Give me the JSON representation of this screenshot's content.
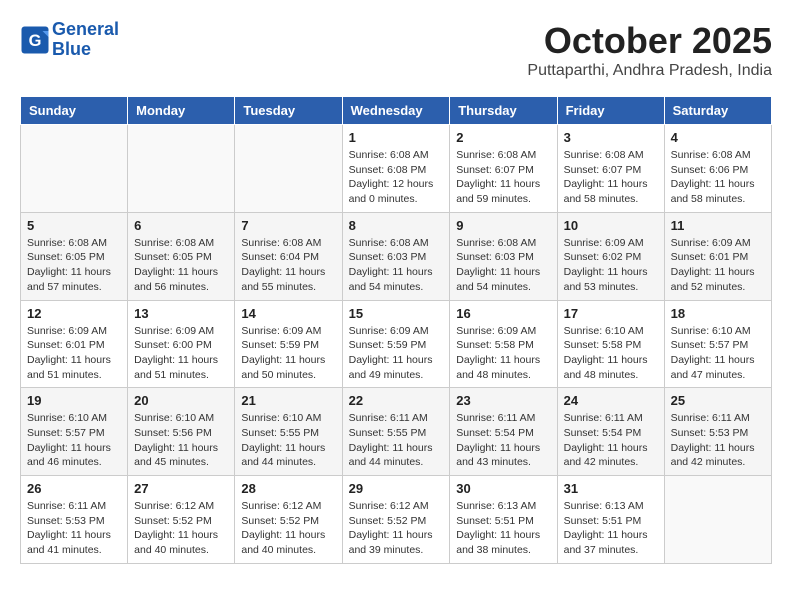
{
  "header": {
    "logo_line1": "General",
    "logo_line2": "Blue",
    "month": "October 2025",
    "location": "Puttaparthi, Andhra Pradesh, India"
  },
  "weekdays": [
    "Sunday",
    "Monday",
    "Tuesday",
    "Wednesday",
    "Thursday",
    "Friday",
    "Saturday"
  ],
  "weeks": [
    [
      {
        "day": "",
        "info": ""
      },
      {
        "day": "",
        "info": ""
      },
      {
        "day": "",
        "info": ""
      },
      {
        "day": "1",
        "info": "Sunrise: 6:08 AM\nSunset: 6:08 PM\nDaylight: 12 hours\nand 0 minutes."
      },
      {
        "day": "2",
        "info": "Sunrise: 6:08 AM\nSunset: 6:07 PM\nDaylight: 11 hours\nand 59 minutes."
      },
      {
        "day": "3",
        "info": "Sunrise: 6:08 AM\nSunset: 6:07 PM\nDaylight: 11 hours\nand 58 minutes."
      },
      {
        "day": "4",
        "info": "Sunrise: 6:08 AM\nSunset: 6:06 PM\nDaylight: 11 hours\nand 58 minutes."
      }
    ],
    [
      {
        "day": "5",
        "info": "Sunrise: 6:08 AM\nSunset: 6:05 PM\nDaylight: 11 hours\nand 57 minutes."
      },
      {
        "day": "6",
        "info": "Sunrise: 6:08 AM\nSunset: 6:05 PM\nDaylight: 11 hours\nand 56 minutes."
      },
      {
        "day": "7",
        "info": "Sunrise: 6:08 AM\nSunset: 6:04 PM\nDaylight: 11 hours\nand 55 minutes."
      },
      {
        "day": "8",
        "info": "Sunrise: 6:08 AM\nSunset: 6:03 PM\nDaylight: 11 hours\nand 54 minutes."
      },
      {
        "day": "9",
        "info": "Sunrise: 6:08 AM\nSunset: 6:03 PM\nDaylight: 11 hours\nand 54 minutes."
      },
      {
        "day": "10",
        "info": "Sunrise: 6:09 AM\nSunset: 6:02 PM\nDaylight: 11 hours\nand 53 minutes."
      },
      {
        "day": "11",
        "info": "Sunrise: 6:09 AM\nSunset: 6:01 PM\nDaylight: 11 hours\nand 52 minutes."
      }
    ],
    [
      {
        "day": "12",
        "info": "Sunrise: 6:09 AM\nSunset: 6:01 PM\nDaylight: 11 hours\nand 51 minutes."
      },
      {
        "day": "13",
        "info": "Sunrise: 6:09 AM\nSunset: 6:00 PM\nDaylight: 11 hours\nand 51 minutes."
      },
      {
        "day": "14",
        "info": "Sunrise: 6:09 AM\nSunset: 5:59 PM\nDaylight: 11 hours\nand 50 minutes."
      },
      {
        "day": "15",
        "info": "Sunrise: 6:09 AM\nSunset: 5:59 PM\nDaylight: 11 hours\nand 49 minutes."
      },
      {
        "day": "16",
        "info": "Sunrise: 6:09 AM\nSunset: 5:58 PM\nDaylight: 11 hours\nand 48 minutes."
      },
      {
        "day": "17",
        "info": "Sunrise: 6:10 AM\nSunset: 5:58 PM\nDaylight: 11 hours\nand 48 minutes."
      },
      {
        "day": "18",
        "info": "Sunrise: 6:10 AM\nSunset: 5:57 PM\nDaylight: 11 hours\nand 47 minutes."
      }
    ],
    [
      {
        "day": "19",
        "info": "Sunrise: 6:10 AM\nSunset: 5:57 PM\nDaylight: 11 hours\nand 46 minutes."
      },
      {
        "day": "20",
        "info": "Sunrise: 6:10 AM\nSunset: 5:56 PM\nDaylight: 11 hours\nand 45 minutes."
      },
      {
        "day": "21",
        "info": "Sunrise: 6:10 AM\nSunset: 5:55 PM\nDaylight: 11 hours\nand 44 minutes."
      },
      {
        "day": "22",
        "info": "Sunrise: 6:11 AM\nSunset: 5:55 PM\nDaylight: 11 hours\nand 44 minutes."
      },
      {
        "day": "23",
        "info": "Sunrise: 6:11 AM\nSunset: 5:54 PM\nDaylight: 11 hours\nand 43 minutes."
      },
      {
        "day": "24",
        "info": "Sunrise: 6:11 AM\nSunset: 5:54 PM\nDaylight: 11 hours\nand 42 minutes."
      },
      {
        "day": "25",
        "info": "Sunrise: 6:11 AM\nSunset: 5:53 PM\nDaylight: 11 hours\nand 42 minutes."
      }
    ],
    [
      {
        "day": "26",
        "info": "Sunrise: 6:11 AM\nSunset: 5:53 PM\nDaylight: 11 hours\nand 41 minutes."
      },
      {
        "day": "27",
        "info": "Sunrise: 6:12 AM\nSunset: 5:52 PM\nDaylight: 11 hours\nand 40 minutes."
      },
      {
        "day": "28",
        "info": "Sunrise: 6:12 AM\nSunset: 5:52 PM\nDaylight: 11 hours\nand 40 minutes."
      },
      {
        "day": "29",
        "info": "Sunrise: 6:12 AM\nSunset: 5:52 PM\nDaylight: 11 hours\nand 39 minutes."
      },
      {
        "day": "30",
        "info": "Sunrise: 6:13 AM\nSunset: 5:51 PM\nDaylight: 11 hours\nand 38 minutes."
      },
      {
        "day": "31",
        "info": "Sunrise: 6:13 AM\nSunset: 5:51 PM\nDaylight: 11 hours\nand 37 minutes."
      },
      {
        "day": "",
        "info": ""
      }
    ]
  ]
}
